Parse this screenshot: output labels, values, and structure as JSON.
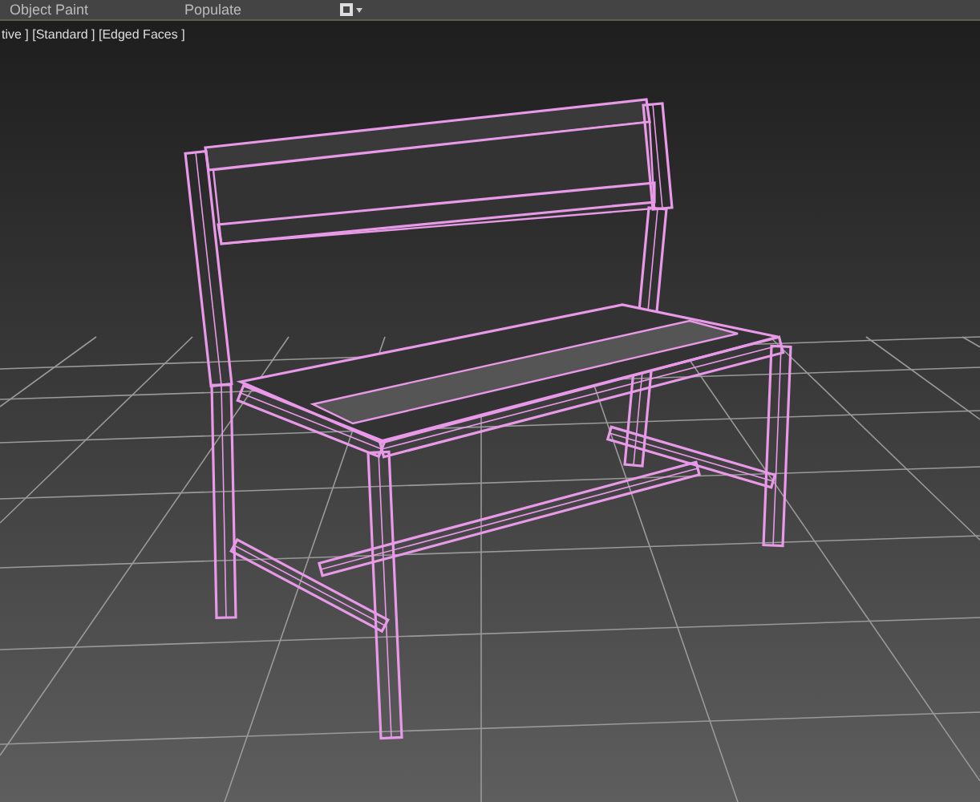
{
  "toolbar": {
    "tabs": [
      {
        "label": "Object Paint"
      },
      {
        "label": "Populate"
      }
    ]
  },
  "viewport": {
    "label": "tive ] [Standard ] [Edged Faces ]"
  }
}
